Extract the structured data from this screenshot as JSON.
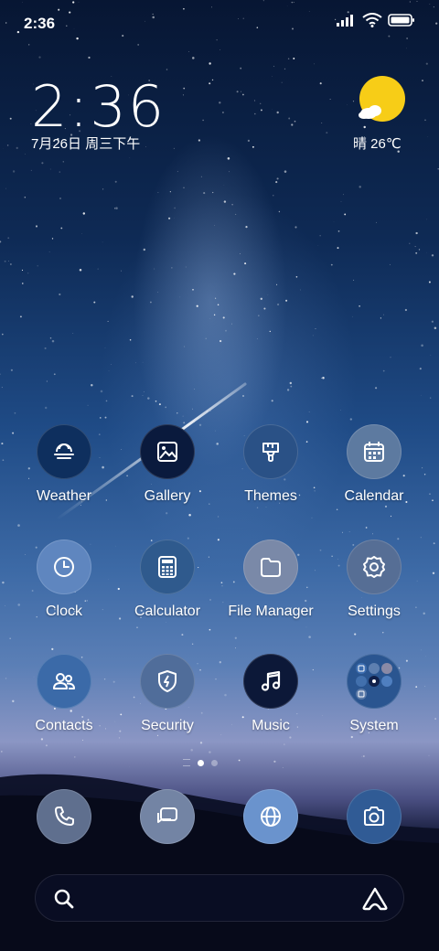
{
  "status_bar": {
    "time": "2:36"
  },
  "clock_widget": {
    "time": "2:36",
    "date": "7月26日 周三下午"
  },
  "weather_widget": {
    "text": "晴 26℃"
  },
  "apps": [
    {
      "label": "Weather",
      "icon": "weather-icon",
      "color": "#0e2f5e"
    },
    {
      "label": "Gallery",
      "icon": "gallery-icon",
      "color": "#0a1a3d"
    },
    {
      "label": "Themes",
      "icon": "themes-icon",
      "color": "#2a5186"
    },
    {
      "label": "Calendar",
      "icon": "calendar-icon",
      "color": "#5d7aa0"
    },
    {
      "label": "Clock",
      "icon": "clock-icon",
      "color": "#5f86bf"
    },
    {
      "label": "Calculator",
      "icon": "calculator-icon",
      "color": "#2f5a8d"
    },
    {
      "label": "File Manager",
      "icon": "folder-icon",
      "color": "#7a89a8"
    },
    {
      "label": "Settings",
      "icon": "settings-icon",
      "color": "#566e95"
    },
    {
      "label": "Contacts",
      "icon": "contacts-icon",
      "color": "#3b6aa8"
    },
    {
      "label": "Security",
      "icon": "security-icon",
      "color": "#506d9a"
    },
    {
      "label": "Music",
      "icon": "music-icon",
      "color": "#0c1838"
    },
    {
      "label": "System",
      "icon": "system-folder-icon",
      "color": "#2a5590"
    }
  ],
  "dock": [
    {
      "icon": "phone-icon",
      "color": "#5f6f8e"
    },
    {
      "icon": "messages-icon",
      "color": "#7384a4"
    },
    {
      "icon": "browser-icon",
      "color": "#6a93cd"
    },
    {
      "icon": "camera-icon",
      "color": "#305b95"
    }
  ],
  "page_indicator": {
    "pages": 3,
    "current": 2
  }
}
